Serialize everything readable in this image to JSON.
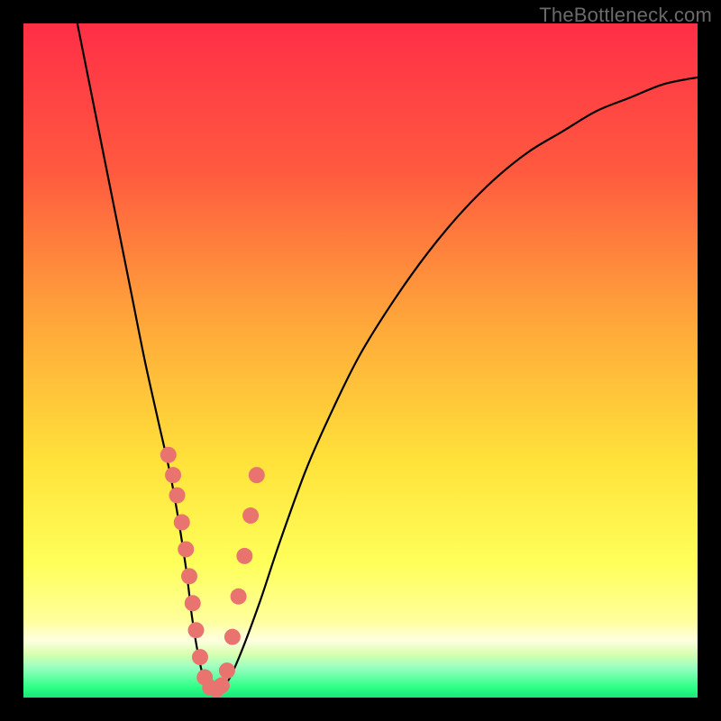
{
  "watermark": "TheBottleneck.com",
  "colors": {
    "black": "#000000",
    "curve": "#000000",
    "marker_fill": "#e9746f",
    "marker_stroke": "#d85f5a",
    "grad_top": "#ff2e47",
    "grad_mid1": "#ff8a3a",
    "grad_mid2": "#ffd83a",
    "grad_yellow": "#ffff66",
    "grad_lightyellow": "#ffffb0",
    "grad_green1": "#b8ff8a",
    "grad_green2": "#2dff86"
  },
  "chart_data": {
    "type": "line",
    "title": "",
    "xlabel": "",
    "ylabel": "",
    "xlim": [
      0,
      100
    ],
    "ylim": [
      0,
      100
    ],
    "series": [
      {
        "name": "bottleneck-curve",
        "x": [
          8,
          10,
          12,
          14,
          16,
          18,
          20,
          22,
          24,
          25,
          26,
          27,
          28,
          30,
          32,
          35,
          38,
          42,
          46,
          50,
          55,
          60,
          65,
          70,
          75,
          80,
          85,
          90,
          95,
          100
        ],
        "y": [
          100,
          90,
          80,
          70,
          60,
          50,
          41,
          32,
          20,
          12,
          6,
          2,
          1,
          2,
          6,
          14,
          23,
          34,
          43,
          51,
          59,
          66,
          72,
          77,
          81,
          84,
          87,
          89,
          91,
          92
        ]
      }
    ],
    "markers": {
      "name": "highlight-points",
      "x": [
        21.5,
        22.2,
        22.8,
        23.5,
        24.1,
        24.6,
        25.1,
        25.6,
        26.2,
        26.9,
        27.7,
        28.6,
        29.4,
        30.2,
        31.0,
        31.9,
        32.8,
        33.7,
        34.6
      ],
      "y": [
        36,
        33,
        30,
        26,
        22,
        18,
        14,
        10,
        6,
        3,
        1.5,
        1.2,
        1.8,
        4,
        9,
        15,
        21,
        27,
        33
      ]
    },
    "gradient_bands": [
      {
        "name": "red",
        "from": 100,
        "to": 60
      },
      {
        "name": "orange",
        "from": 60,
        "to": 40
      },
      {
        "name": "yellow",
        "from": 40,
        "to": 15
      },
      {
        "name": "light-yellow",
        "from": 15,
        "to": 8
      },
      {
        "name": "green",
        "from": 8,
        "to": 0
      }
    ]
  }
}
